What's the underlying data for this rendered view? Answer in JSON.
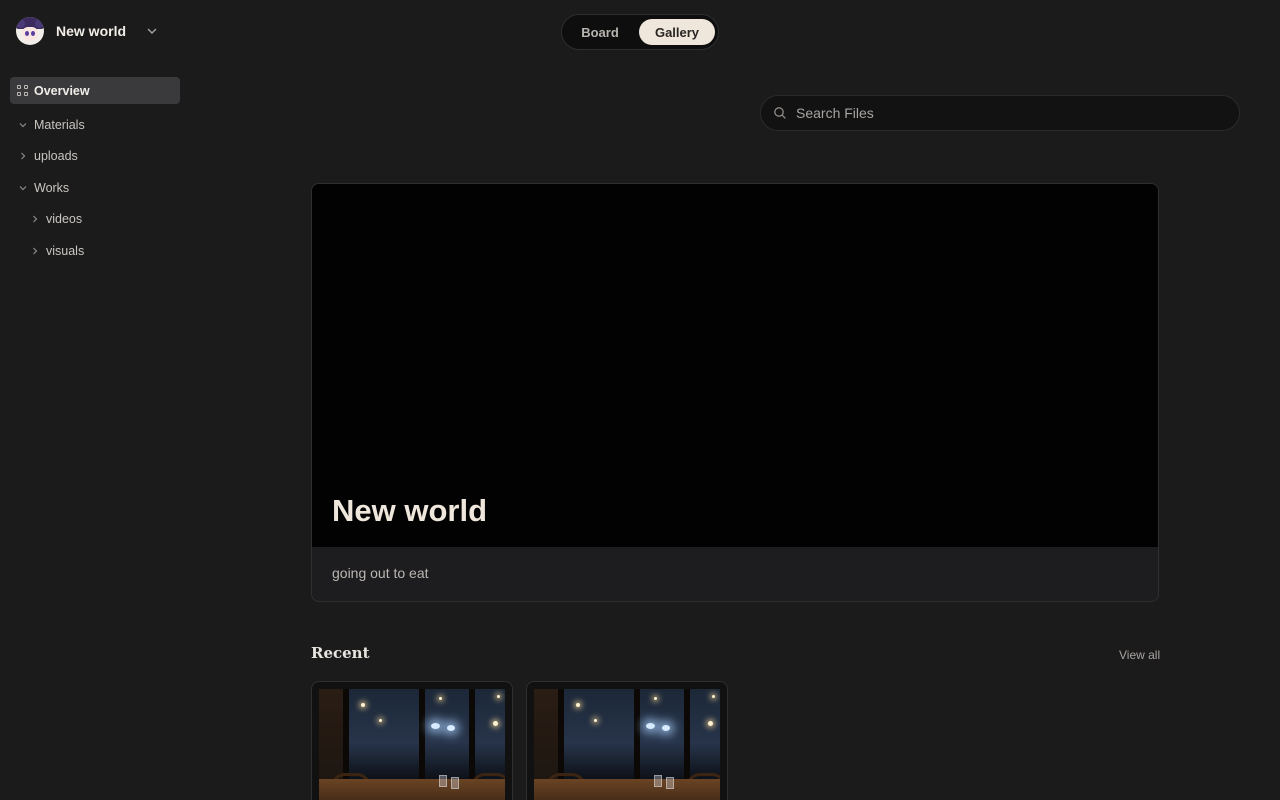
{
  "workspace": {
    "name": "New world"
  },
  "sidebar": {
    "overview_label": "Overview",
    "items": [
      {
        "label": "Materials",
        "expanded": true
      },
      {
        "label": "uploads",
        "expanded": false
      },
      {
        "label": "Works",
        "expanded": true
      },
      {
        "label": "videos",
        "expanded": false
      },
      {
        "label": "visuals",
        "expanded": false
      }
    ]
  },
  "view_toggle": {
    "options": [
      "Board",
      "Gallery"
    ],
    "selected": "Gallery"
  },
  "search": {
    "placeholder": "Search Files",
    "value": ""
  },
  "hero": {
    "title": "New world",
    "description": "going out to eat"
  },
  "recent": {
    "title": "Recent",
    "view_all_label": "View all",
    "thumbnails": 2
  },
  "colors": {
    "background": "#1b1b1c",
    "accent": "#efe6dc",
    "banner": "#020202"
  }
}
